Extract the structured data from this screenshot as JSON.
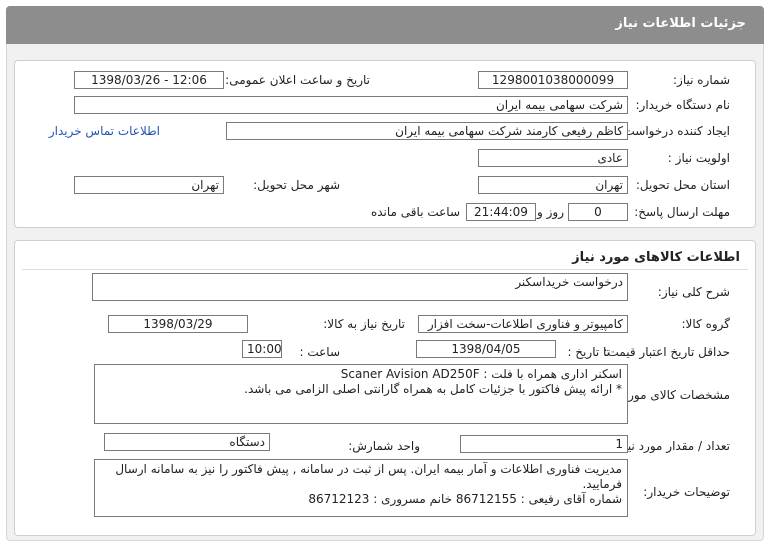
{
  "page": {
    "title": "جزئیات اطلاعات نیاز"
  },
  "info": {
    "need_number_label": "شماره نیاز:",
    "need_number": "1298001038000099",
    "announce_label": "تاریخ و ساعت اعلان عمومی:",
    "announce_value": "1398/03/26 - 12:06",
    "buyer_org_label": "نام دستگاه خریدار:",
    "buyer_org": "شرکت سهامی بیمه ایران",
    "creator_label": "ایجاد کننده درخواست:",
    "creator": "کاظم رفیعی کارمند شرکت سهامی بیمه ایران",
    "contact_link": "اطلاعات تماس خریدار",
    "priority_label": "اولویت نیاز :",
    "priority": "عادی",
    "province_label": "استان محل تحویل:",
    "province": "تهران",
    "city_label": "شهر محل تحویل:",
    "city": "تهران",
    "deadline_label": "مهلت ارسال پاسخ:",
    "days": "0",
    "days_label": "روز و",
    "time_left": "21:44:09",
    "time_left_label": "ساعت باقی مانده"
  },
  "goods": {
    "section_title": "اطلاعات کالاهای مورد نیاز",
    "summary_label": "شرح کلی نیاز:",
    "summary": "درخواست خریداسکنر",
    "group_label": "گروه کالا:",
    "group": "کامپیوتر و فناوری اطلاعات-سخت افزار",
    "need_date_label": "تاریخ نیاز به کالا:",
    "need_date": "1398/03/29",
    "validity_label": "حداقل تاریخ اعتبار قیمت:",
    "to_date_label": "تا تاریخ :",
    "validity_date": "1398/04/05",
    "time_label": "ساعت :",
    "validity_time": "10:00",
    "specs_label": "مشخصات کالای مورد نیاز:",
    "specs_line1": "اسکنر اداری همراه با فلت : Scaner Avision AD250F",
    "specs_line2": "* ارائه پیش فاکتور با جزئیات کامل به همراه گارانتی اصلی الزامی می باشد.",
    "qty_label": "تعداد / مقدار مورد نیاز:",
    "qty": "1",
    "unit_label": "واحد شمارش:",
    "unit": "دستگاه",
    "notes_label": "توضیحات خریدار:",
    "notes_line1": "مدیریت فناوری اطلاعات و آمار بیمه ایران. پس از ثبت در سامانه , پیش فاکتور را نیز به سامانه ارسال فرمایید.",
    "notes_line2": "شماره آقای رفیعی : 86712155 خانم مسروری : 86712123"
  }
}
